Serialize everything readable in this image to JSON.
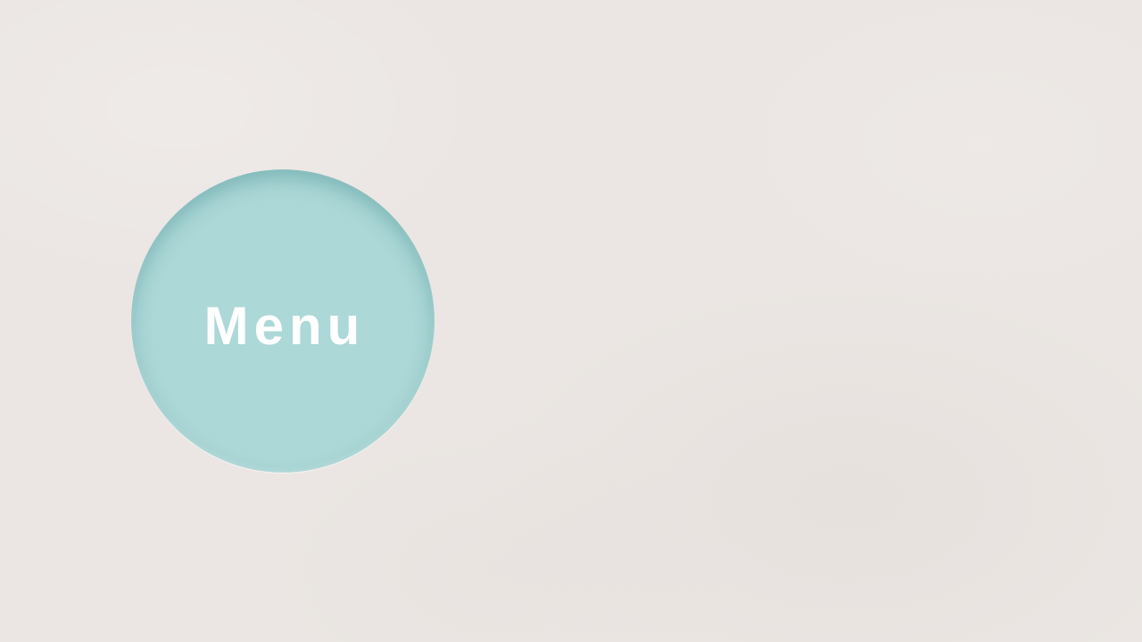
{
  "menu": {
    "label": "Menu"
  },
  "colors": {
    "background": "#ebe6e3",
    "circle": "#acd8d7",
    "label": "#ffffff"
  }
}
